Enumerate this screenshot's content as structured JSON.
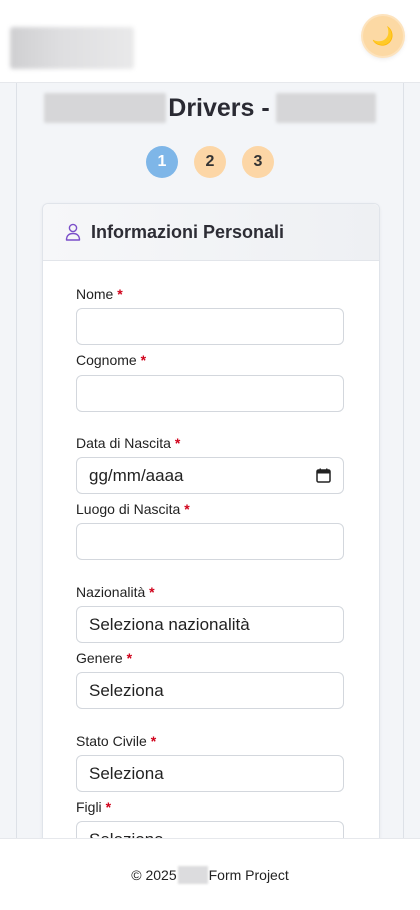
{
  "header": {
    "theme_icon": "moon-icon",
    "theme_glyph": "🌙"
  },
  "page": {
    "title_visible": "Drivers -"
  },
  "steps": [
    {
      "label": "1",
      "state": "active"
    },
    {
      "label": "2",
      "state": "pending"
    },
    {
      "label": "3",
      "state": "pending"
    }
  ],
  "section": {
    "title": "Informazioni Personali",
    "icon": "user-icon"
  },
  "fields": {
    "nome": {
      "label": "Nome",
      "value": ""
    },
    "cognome": {
      "label": "Cognome",
      "value": ""
    },
    "data_nascita": {
      "label": "Data di Nascita",
      "placeholder": "gg/mm/aaaa"
    },
    "luogo_nascita": {
      "label": "Luogo di Nascita",
      "value": ""
    },
    "nazionalita": {
      "label": "Nazionalità",
      "value": "Seleziona nazionalità"
    },
    "genere": {
      "label": "Genere",
      "value": "Seleziona"
    },
    "stato_civile": {
      "label": "Stato Civile",
      "value": "Seleziona"
    },
    "figli": {
      "label": "Figli",
      "value": "Seleziona"
    }
  },
  "required_mark": "*",
  "footer": {
    "prefix": "© 2025",
    "suffix": "Form Project"
  },
  "colors": {
    "step_active": "#7eb6e8",
    "step_pending": "#fcd6a6",
    "required": "#d0021b",
    "accent_icon": "#7b4fc9"
  }
}
